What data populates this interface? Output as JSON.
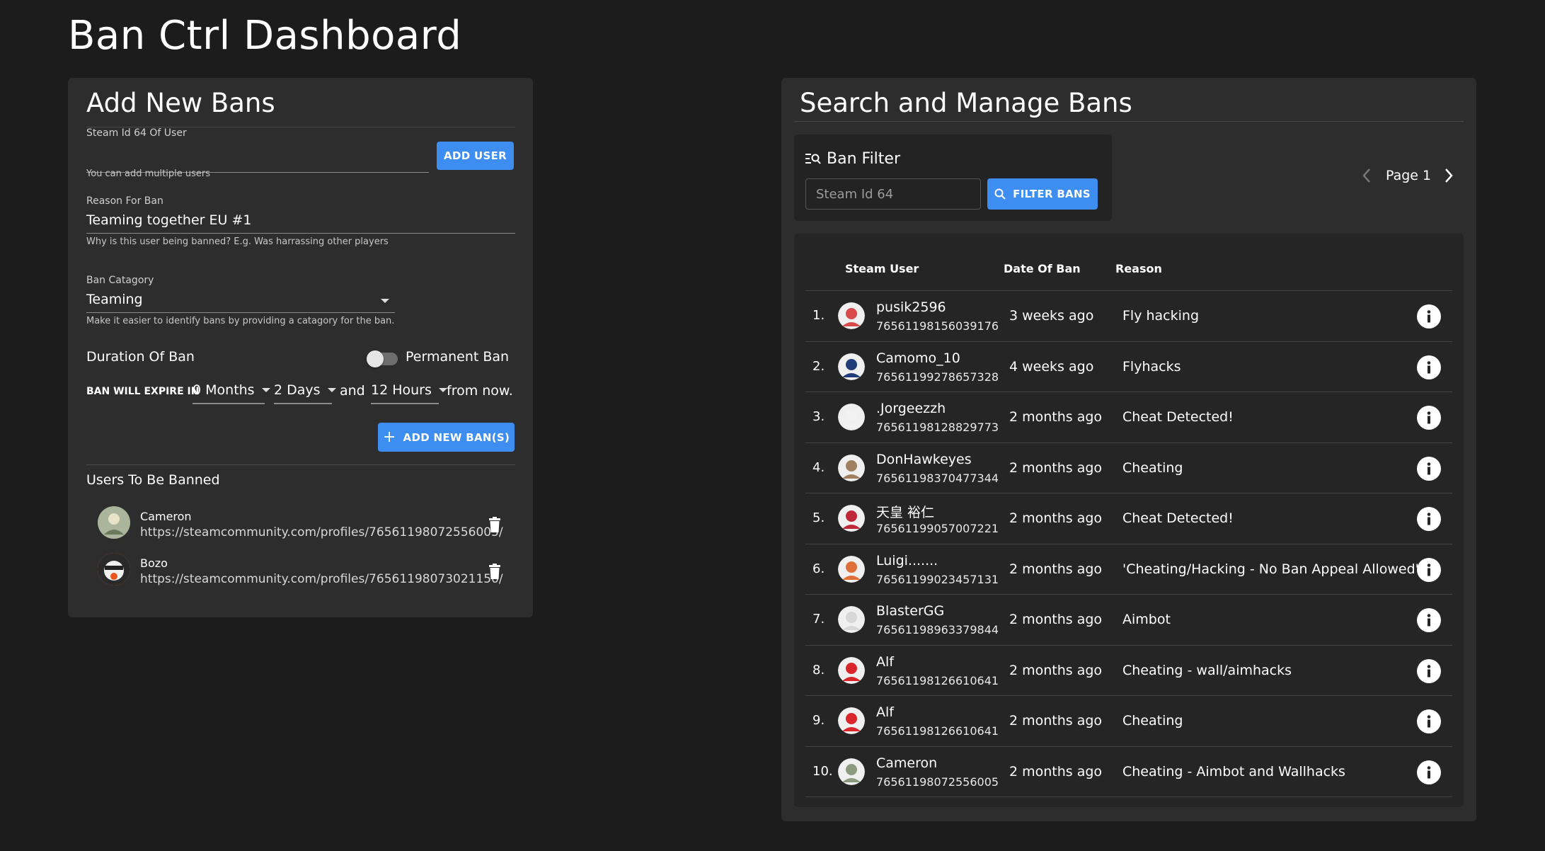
{
  "page": {
    "title": "Ban Ctrl Dashboard"
  },
  "add_bans": {
    "title": "Add New Bans",
    "steam_id": {
      "label": "Steam Id 64 Of User",
      "value": "",
      "helper": "You can add multiple users"
    },
    "add_user_button": "ADD USER",
    "reason": {
      "label": "Reason For Ban",
      "value": "Teaming together EU #1",
      "helper": "Why is this user being banned? E.g. Was harrassing other players"
    },
    "category": {
      "label": "Ban Catagory",
      "value": "Teaming",
      "helper": "Make it easier to identify bans by providing a catagory for the ban."
    },
    "duration": {
      "label": "Duration Of Ban",
      "permanent_label": "Permanent Ban",
      "permanent_on": false,
      "expire_label": "BAN WILL EXPIRE IN",
      "months": "0 Months",
      "days": "2 Days",
      "and_label": "and",
      "hours": "12 Hours",
      "suffix": "from now."
    },
    "add_new_ban_button": "ADD NEW BAN(S)",
    "users_to_ban": {
      "title": "Users To Be Banned",
      "items": [
        {
          "name": "Cameron",
          "url": "https://steamcommunity.com/profiles/76561198072556005/",
          "avatar_color": "#8c9a80"
        },
        {
          "name": "Bozo",
          "url": "https://steamcommunity.com/profiles/76561198073021150/",
          "avatar_color": "#d9743a"
        }
      ]
    }
  },
  "manage": {
    "title": "Search and Manage Bans",
    "filter": {
      "title": "Ban Filter",
      "placeholder": "Steam Id 64",
      "button": "FILTER BANS"
    },
    "pager": {
      "label": "Page 1"
    },
    "columns": {
      "user": "Steam User",
      "date": "Date Of Ban",
      "reason": "Reason"
    },
    "rows": [
      {
        "idx": "1.",
        "name": "pusik2596",
        "id": "76561198156039176",
        "date": "3 weeks ago",
        "reason": "Fly hacking",
        "avatar_color": "#d94a4a"
      },
      {
        "idx": "2.",
        "name": "Camomo_10",
        "id": "76561199278657328",
        "date": "4 weeks ago",
        "reason": "Flyhacks",
        "avatar_color": "#1f3d7a"
      },
      {
        "idx": "3.",
        "name": ".Jorgeezzh",
        "id": "76561198128829773",
        "date": "2 months ago",
        "reason": "Cheat Detected!",
        "avatar_color": "#f2f2f2"
      },
      {
        "idx": "4.",
        "name": "DonHawkeyes",
        "id": "76561198370477344",
        "date": "2 months ago",
        "reason": "Cheating",
        "avatar_color": "#a08060"
      },
      {
        "idx": "5.",
        "name": "天皇 裕仁",
        "id": "76561199057007221",
        "date": "2 months ago",
        "reason": "Cheat Detected!",
        "avatar_color": "#c0283a"
      },
      {
        "idx": "6.",
        "name": "Luigi.......",
        "id": "76561199023457131",
        "date": "2 months ago",
        "reason": "'Cheating/Hacking - No Ban Appeal Allowed'",
        "avatar_color": "#e0703a"
      },
      {
        "idx": "7.",
        "name": "BlasterGG",
        "id": "76561198963379844",
        "date": "2 months ago",
        "reason": "Aimbot",
        "avatar_color": "#d8d8d8"
      },
      {
        "idx": "8.",
        "name": "Alf",
        "id": "76561198126610641",
        "date": "2 months ago",
        "reason": "Cheating - wall/aimhacks",
        "avatar_color": "#d8262a"
      },
      {
        "idx": "9.",
        "name": "Alf",
        "id": "76561198126610641",
        "date": "2 months ago",
        "reason": "Cheating",
        "avatar_color": "#d8262a"
      },
      {
        "idx": "10.",
        "name": "Cameron",
        "id": "76561198072556005",
        "date": "2 months ago",
        "reason": "Cheating - Aimbot and Wallhacks",
        "avatar_color": "#8c9a80"
      }
    ]
  }
}
